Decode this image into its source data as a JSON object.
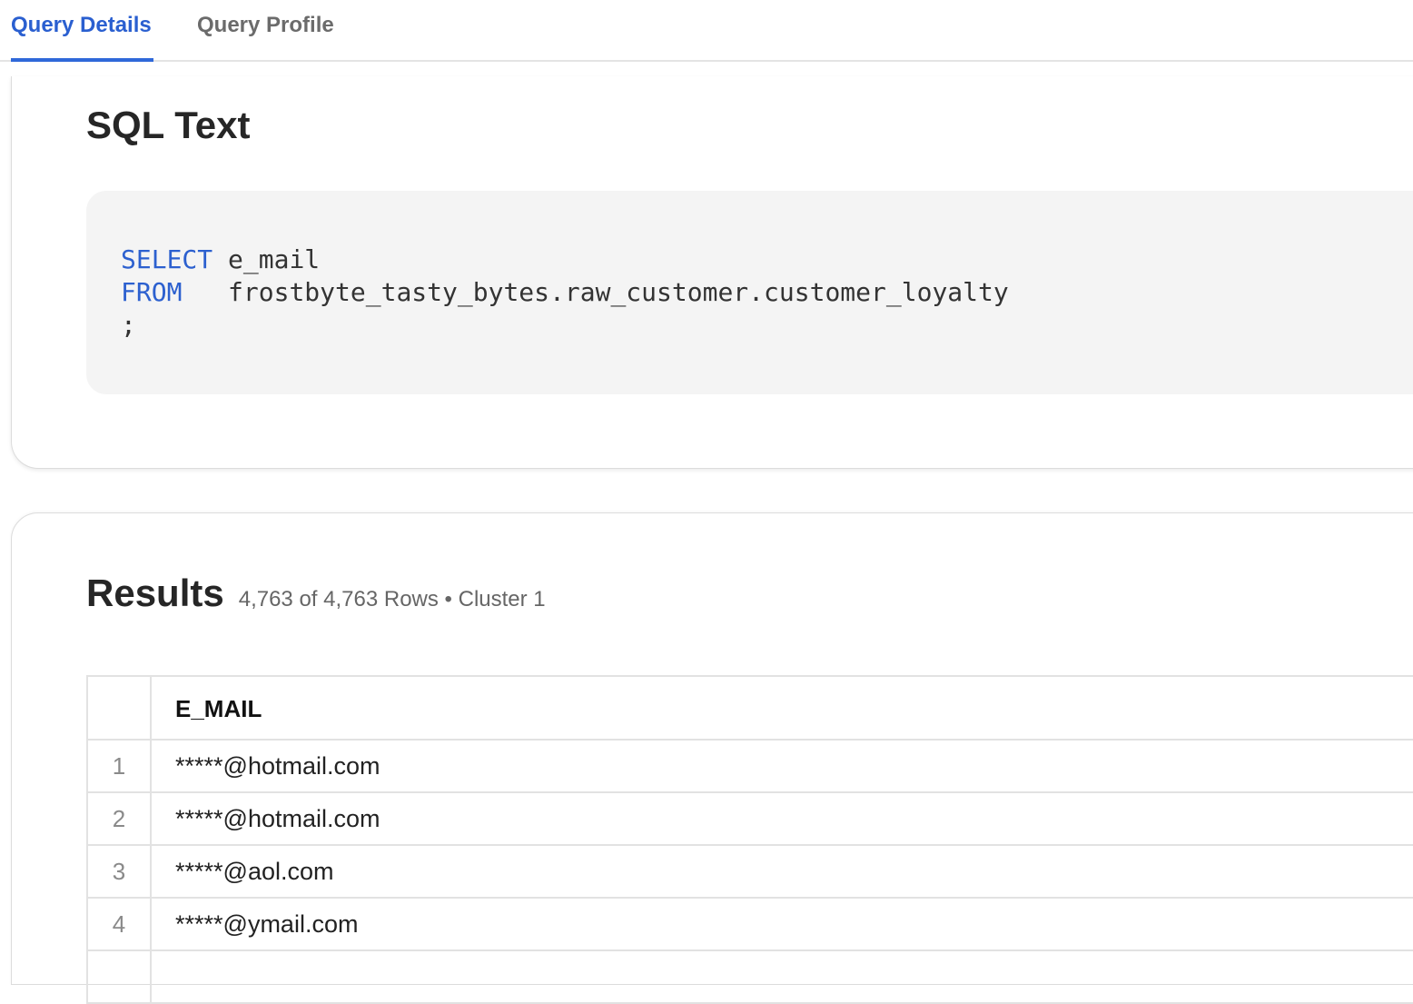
{
  "tabs": [
    {
      "label": "Query Details",
      "active": true
    },
    {
      "label": "Query Profile",
      "active": false
    }
  ],
  "sql": {
    "title": "SQL Text",
    "lines": [
      {
        "keyword": "SELECT",
        "rest": " e_mail"
      },
      {
        "keyword": "FROM",
        "rest": "   frostbyte_tasty_bytes.raw_customer.customer_loyalty"
      },
      {
        "keyword": "",
        "rest": ";"
      }
    ]
  },
  "results": {
    "title": "Results",
    "meta": "4,763 of 4,763 Rows • Cluster 1",
    "columns": [
      "E_MAIL"
    ],
    "rows": [
      {
        "index": "1",
        "value": "*****@hotmail.com"
      },
      {
        "index": "2",
        "value": "*****@hotmail.com"
      },
      {
        "index": "3",
        "value": "*****@aol.com"
      },
      {
        "index": "4",
        "value": "*****@ymail.com"
      }
    ]
  },
  "colors": {
    "accent": "#2f68d9",
    "keyword": "#2c60cf"
  }
}
